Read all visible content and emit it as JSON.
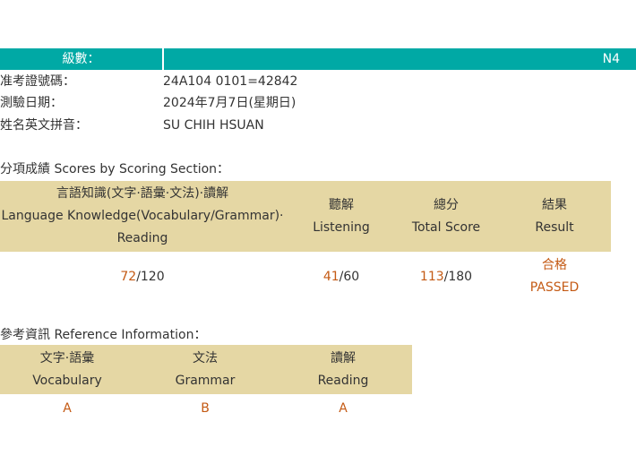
{
  "header": {
    "level_label": "級數：",
    "level_value": "N4"
  },
  "info": {
    "registration": {
      "label": "准考證號碼：",
      "value": "24A104 0101=42842"
    },
    "test_date": {
      "label": "測驗日期：",
      "value": "2024年7月7日(星期日)"
    },
    "name": {
      "label": "姓名英文拼音：",
      "value": "SU CHIH HSUAN"
    }
  },
  "scores": {
    "title": "分項成績 Scores by Scoring Section：",
    "headers": {
      "language_zh": "言語知識(文字·語彙·文法)·讀解",
      "language_en1": "Language Knowledge(Vocabulary/Grammar)·",
      "language_en2": "Reading",
      "listening_zh": "聽解",
      "listening_en": "Listening",
      "total_zh": "總分",
      "total_en": "Total Score",
      "result_zh": "結果",
      "result_en": "Result"
    },
    "values": {
      "language_score": "72",
      "language_max": "/120",
      "listening_score": "41",
      "listening_max": "/60",
      "total_score": "113",
      "total_max": "/180",
      "result_zh": "合格",
      "result_en": "PASSED"
    }
  },
  "reference": {
    "title": "參考資訊 Reference Information：",
    "headers": {
      "vocab_zh": "文字·語彙",
      "vocab_en": "Vocabulary",
      "grammar_zh": "文法",
      "grammar_en": "Grammar",
      "reading_zh": "讀解",
      "reading_en": "Reading"
    },
    "grades": {
      "vocab": "A",
      "grammar": "B",
      "reading": "A"
    }
  },
  "colors": {
    "header_bar": "#00a9a5",
    "table_header": "#e5d7a4",
    "accent": "#c45a14"
  }
}
